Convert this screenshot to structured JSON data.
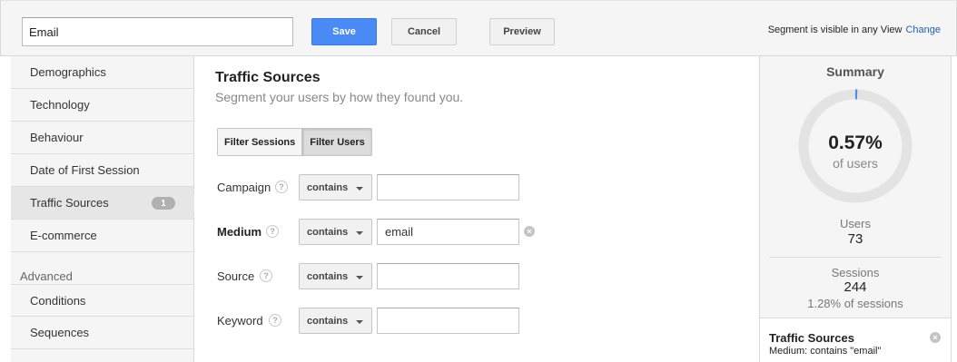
{
  "header": {
    "segment_name": "Email",
    "save_label": "Save",
    "cancel_label": "Cancel",
    "preview_label": "Preview",
    "visibility_text": "Segment is visible in any View",
    "change_label": "Change"
  },
  "sidebar": {
    "items": [
      {
        "label": "Demographics"
      },
      {
        "label": "Technology"
      },
      {
        "label": "Behaviour"
      },
      {
        "label": "Date of First Session"
      },
      {
        "label": "Traffic Sources",
        "badge": "1",
        "active": true
      },
      {
        "label": "E-commerce"
      }
    ],
    "advanced_heading": "Advanced",
    "advanced_items": [
      {
        "label": "Conditions"
      },
      {
        "label": "Sequences"
      }
    ]
  },
  "main": {
    "title": "Traffic Sources",
    "subtitle": "Segment your users by how they found you.",
    "filter_toggle": {
      "sessions_label": "Filter Sessions",
      "users_label": "Filter Users",
      "selected": "Filter Users"
    },
    "help_glyph": "?",
    "clear_glyph": "×",
    "fields": [
      {
        "label": "Campaign",
        "operator": "contains",
        "value": ""
      },
      {
        "label": "Medium",
        "operator": "contains",
        "value": "email"
      },
      {
        "label": "Source",
        "operator": "contains",
        "value": ""
      },
      {
        "label": "Keyword",
        "operator": "contains",
        "value": ""
      }
    ]
  },
  "summary": {
    "title": "Summary",
    "percent": "0.57%",
    "percent_fraction": 0.0057,
    "percent_label": "of users",
    "users_label": "Users",
    "users_value": "73",
    "sessions_label": "Sessions",
    "sessions_value": "244",
    "sessions_pct": "1.28% of sessions",
    "condition": {
      "title": "Traffic Sources",
      "detail": "Medium: contains \"email\"",
      "remove_glyph": "×"
    }
  },
  "colors": {
    "primary_button": "#4a8af4",
    "link": "#1a5fb4",
    "donut_track": "#e3e3e3",
    "donut_fill": "#4a8af4"
  },
  "icons": [
    "help-icon",
    "clear-icon",
    "chevron-down-icon",
    "remove-condition-icon"
  ]
}
